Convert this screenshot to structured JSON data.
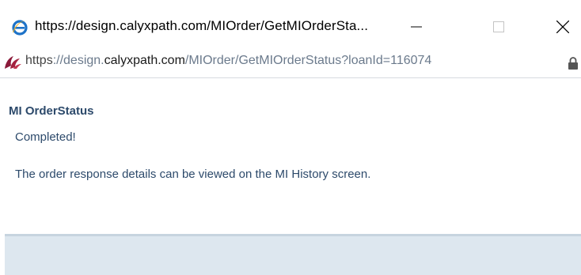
{
  "window": {
    "title": "https://design.calyxpath.com/MIOrder/GetMIOrderSta...",
    "icons": {
      "app": "internet-explorer-icon",
      "minimize": "minimize-icon",
      "maximize": "maximize-icon",
      "close": "close-icon"
    }
  },
  "address_bar": {
    "protocol": "https",
    "separator": "://",
    "subdomain": "design.",
    "domain": "calyxpath.com",
    "path": "/MIOrder/GetMIOrderStatus?loanId=116074",
    "site_icon": "calyx-site-icon",
    "lock_icon": "lock-icon"
  },
  "content": {
    "heading": "MI OrderStatus",
    "status": "Completed!",
    "detail": "The order response details can be viewed on the MI History screen."
  },
  "colors": {
    "heading_text": "#2d4a6b",
    "footer_bg": "#dde7ef",
    "ie_blue": "#1e73c8",
    "ie_ring": "#f2b01e",
    "site_icon": "#8b1a3a"
  }
}
